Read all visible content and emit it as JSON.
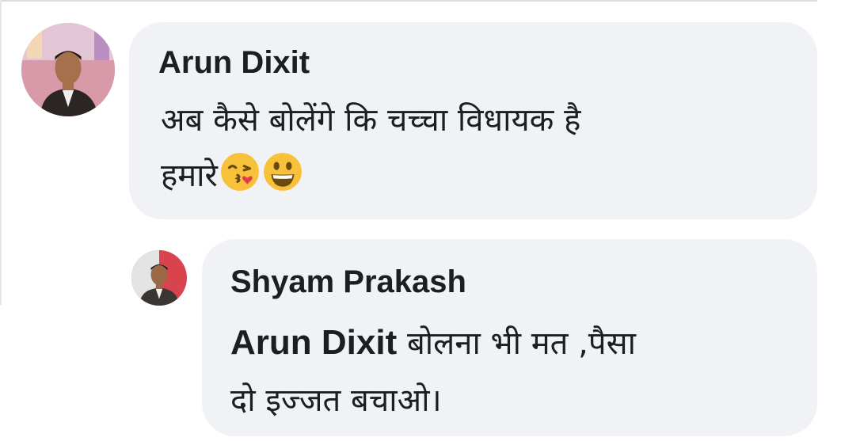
{
  "comments": [
    {
      "author": "Arun Dixit",
      "lines": [
        "अब कैसे बोलेंगे कि चच्चा  विधायक है",
        "हमारे"
      ],
      "emojis": [
        "face-throwing-kiss-icon",
        "grinning-face-icon"
      ]
    },
    {
      "author": "Shyam Prakash",
      "mention": "Arun Dixit",
      "lines": [
        "बोलना भी मत ,पैसा",
        "दो इज्जत बचाओ।"
      ]
    }
  ],
  "colors": {
    "bubble_background": "#f0f2f5",
    "text": "#1c1e21",
    "divider": "#dadde1"
  }
}
